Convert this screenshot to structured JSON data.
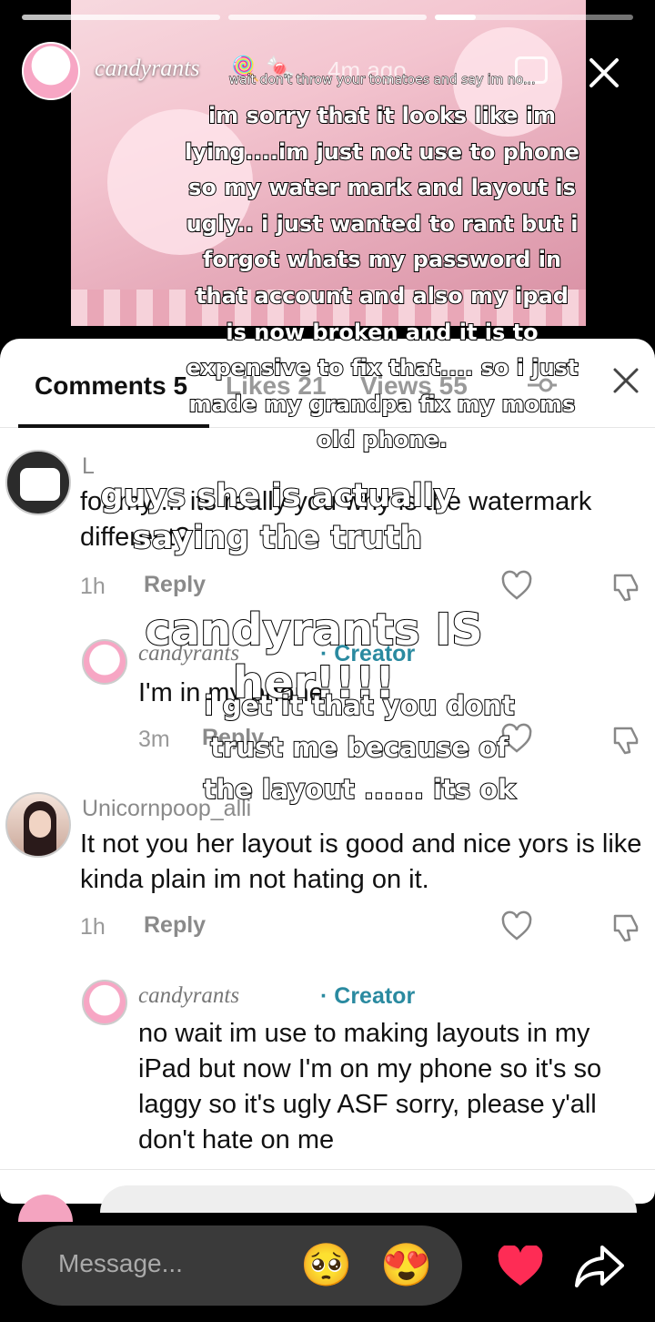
{
  "story": {
    "username": "candyrants",
    "time": "4m ago",
    "caption_top": "wait don't throw your tomatoes and say im no...",
    "overlay_main": "im sorry that it looks like im lying....im just not use to phone so my water mark and layout is ugly.. i just wanted to rant but i forgot whats my password in that account and also my ipad is now broken and it is to expensive to fix that.... so i just made my grandpa fix my moms old phone.",
    "overlay_2": "guys she is actually saying the truth",
    "overlay_3": "candyrants IS her!!!!",
    "overlay_4": "i get it that you dont trust me because of the layout ...... its ok"
  },
  "sheet": {
    "tab_comments": "Comments 5",
    "tab_likes": "Likes 21",
    "tab_views": "Views 55"
  },
  "comments": [
    {
      "name": "L",
      "text": "for my ... its really you why is the watermark different?",
      "time": "1h",
      "reply": "Reply"
    },
    {
      "name": "candyrants",
      "creator": "· Creator",
      "text": "I'm in my phone",
      "time": "3m",
      "reply": "Reply"
    },
    {
      "name": "Unicornpoop_alli",
      "text": "It not you her layout is good and nice yors is like kinda plain im not hating on it.",
      "time": "1h",
      "reply": "Reply"
    },
    {
      "name": "candyrants",
      "creator": "· Creator",
      "text": "no wait im use to making layouts in my iPad but now I'm on my phone so it's so laggy so it's ugly ASF sorry, please y'all don't hate on me"
    }
  ],
  "message_bar": {
    "placeholder": "Message...",
    "emoji_1": "🥺",
    "emoji_2": "😍"
  },
  "colors": {
    "accent_heart": "#fe2c55",
    "creator": "#2a8aa0"
  }
}
